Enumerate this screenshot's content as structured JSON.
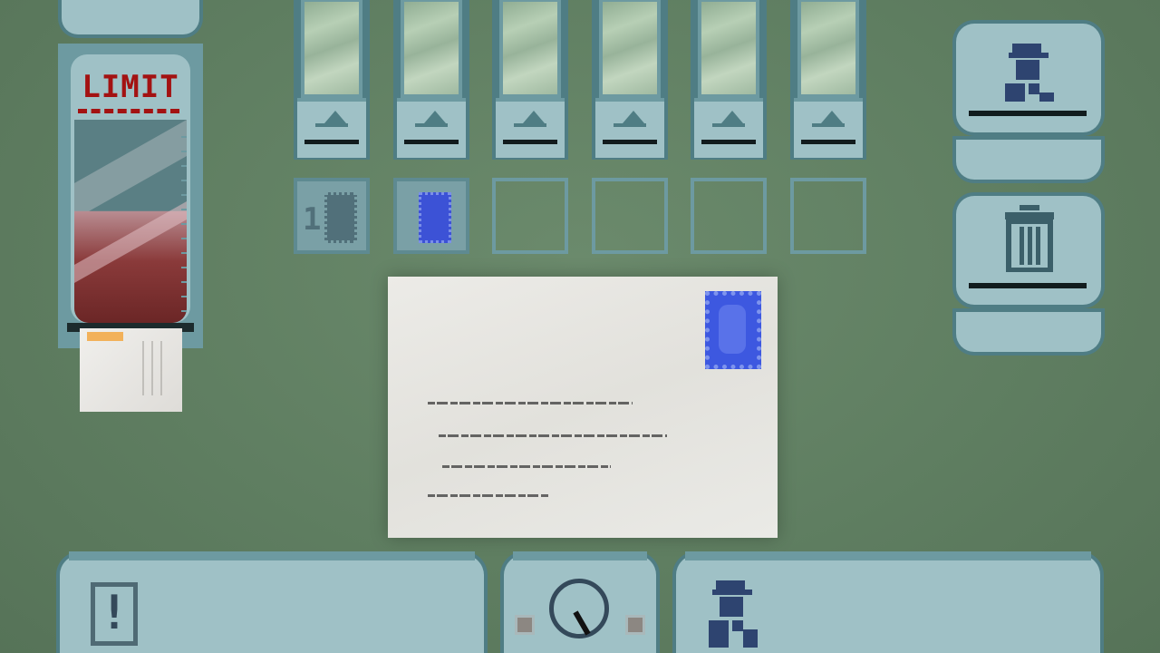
{
  "limit_meter": {
    "label": "LIMIT",
    "fill_level": 0.55,
    "colors": {
      "label": "#a31212",
      "fill_top": "#b98d92",
      "fill_bottom": "#6b2626"
    }
  },
  "sorting_slots": [
    {
      "stamp_count": "1",
      "stamp_color": "grey"
    },
    {
      "stamp_count": "",
      "stamp_color": "blue"
    },
    {
      "stamp_count": "",
      "stamp_color": ""
    },
    {
      "stamp_count": "",
      "stamp_color": ""
    },
    {
      "stamp_count": "",
      "stamp_color": ""
    },
    {
      "stamp_count": "",
      "stamp_color": ""
    }
  ],
  "side_buttons": [
    {
      "icon": "postman-icon"
    },
    {
      "icon": "trash-icon"
    }
  ],
  "letter": {
    "stamp_color": "#3d58e0"
  },
  "bottom_bar": {
    "alert_symbol": "!",
    "clock_icon": "clock-icon",
    "worker_icon": "postman-icon"
  }
}
